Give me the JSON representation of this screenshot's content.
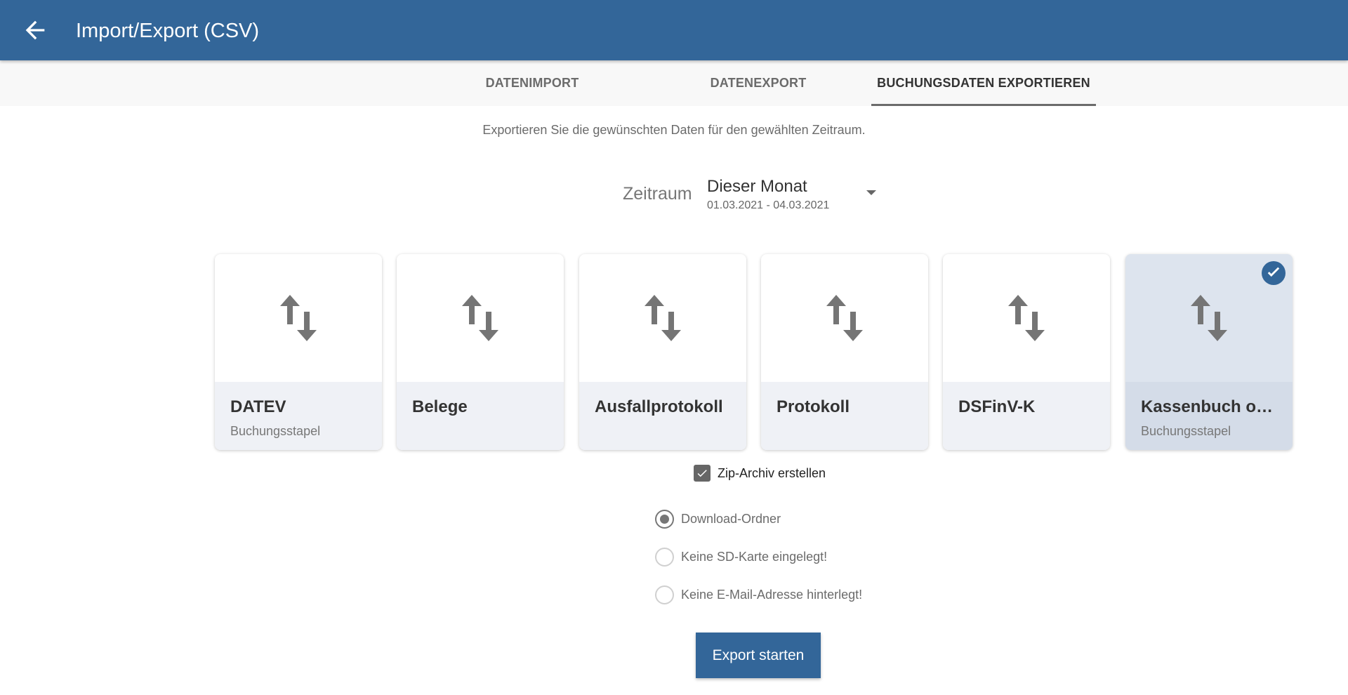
{
  "appbar": {
    "title": "Import/Export (CSV)",
    "back_icon": "arrow-left-icon",
    "color": "#336699"
  },
  "tabs": [
    {
      "label": "DATENIMPORT",
      "active": false
    },
    {
      "label": "DATENEXPORT",
      "active": false
    },
    {
      "label": "BUCHUNGSDATEN EXPORTIEREN",
      "active": true
    }
  ],
  "subtitle": "Exportieren Sie die gewünschten Daten für den gewählten Zeitraum.",
  "period": {
    "label": "Zeitraum",
    "value": "Dieser Monat",
    "range": "01.03.2021 - 04.03.2021"
  },
  "cards": [
    {
      "title": "DATEV",
      "subtitle": "Buchungsstapel",
      "icon": "swap-vertical-icon",
      "selected": false
    },
    {
      "title": "Belege",
      "subtitle": "",
      "icon": "swap-vertical-icon",
      "selected": false
    },
    {
      "title": "Ausfallprotokoll",
      "subtitle": "",
      "icon": "swap-vertical-icon",
      "selected": false
    },
    {
      "title": "Protokoll",
      "subtitle": "",
      "icon": "swap-vertical-icon",
      "selected": false
    },
    {
      "title": "DSFinV-K",
      "subtitle": "",
      "icon": "swap-vertical-icon",
      "selected": false
    },
    {
      "title": "Kassenbuch onl...",
      "subtitle": "Buchungsstapel",
      "icon": "swap-vertical-icon",
      "selected": true
    }
  ],
  "zip": {
    "label": "Zip-Archiv erstellen",
    "checked": true
  },
  "destinations": [
    {
      "label": "Download-Ordner",
      "checked": true
    },
    {
      "label": "Keine SD-Karte eingelegt!",
      "checked": false
    },
    {
      "label": "Keine E-Mail-Adresse hinterlegt!",
      "checked": false
    }
  ],
  "export_button": {
    "label": "Export starten"
  }
}
